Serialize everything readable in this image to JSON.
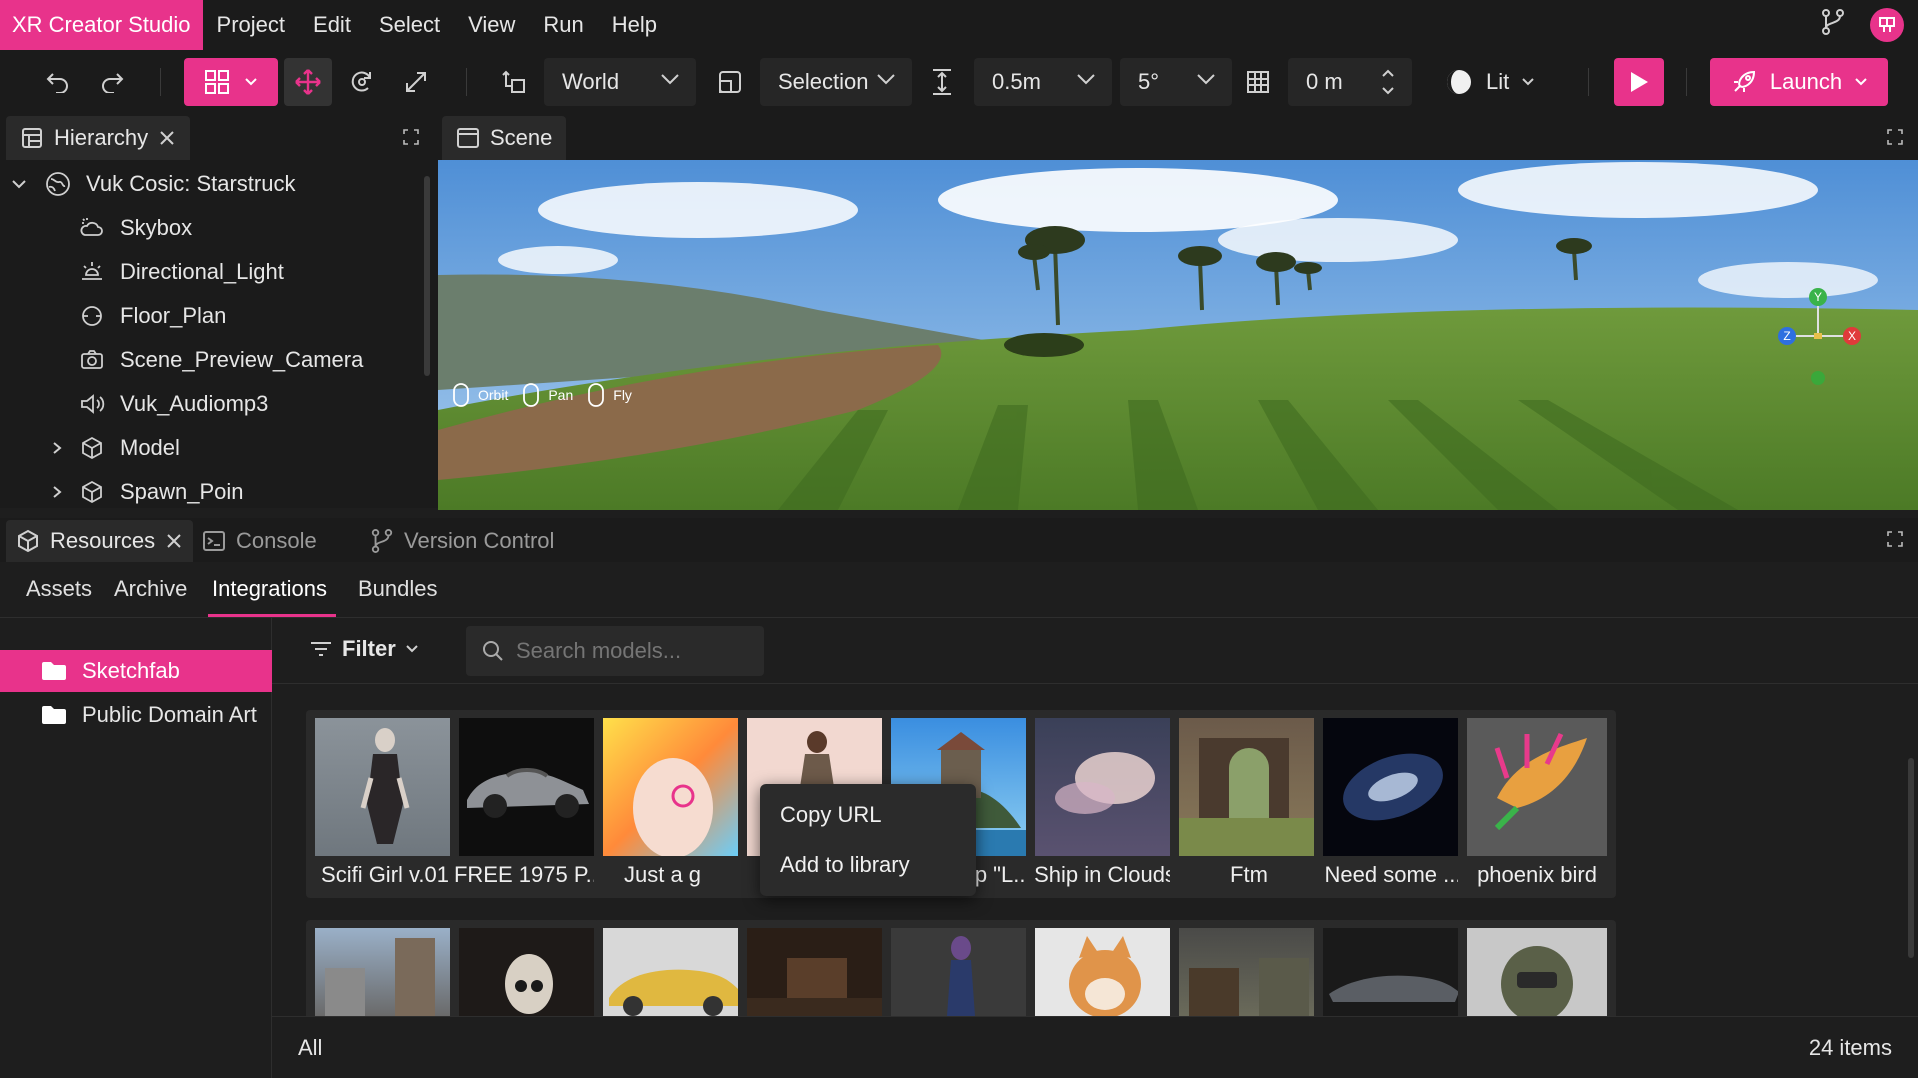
{
  "app": {
    "title": "XR Creator Studio",
    "accent": "#e8338b"
  },
  "menu": [
    "Project",
    "Edit",
    "Select",
    "View",
    "Run",
    "Help"
  ],
  "toolbar": {
    "space": "World",
    "pivot": "Selection",
    "translate_snap": "0.5m",
    "rotate_snap": "5°",
    "grid_height": "0 m",
    "render_mode": "Lit",
    "launch": "Launch"
  },
  "hierarchy": {
    "title": "Hierarchy",
    "root": "Vuk Cosic: Starstruck",
    "items": [
      "Skybox",
      "Directional_Light",
      "Floor_Plan",
      "Scene_Preview_Camera",
      "Vuk_Audiomp3",
      "Model",
      "Spawn_Poin"
    ]
  },
  "scene": {
    "title": "Scene",
    "controls": [
      "Orbit",
      "Pan",
      "Fly"
    ],
    "axes": {
      "y": "Y",
      "z": "Z",
      "x": "X"
    }
  },
  "resources": {
    "tabs": [
      "Resources",
      "Console",
      "Version Control"
    ],
    "subtabs": [
      "Assets",
      "Archive",
      "Integrations",
      "Bundles"
    ],
    "sources": [
      "Sketchfab",
      "Public Domain Art"
    ],
    "filter": "Filter",
    "search_placeholder": "Search models...",
    "models": [
      "Scifi Girl v.01",
      "FREE 1975 P...",
      "Just a g",
      "",
      "Sea Keep \"L...",
      "Ship in Clouds",
      "Ftm",
      "Need some ...",
      "phoenix bird"
    ],
    "footer_left": "All",
    "footer_count": "24 items"
  },
  "context_menu": [
    "Copy URL",
    "Add to library"
  ]
}
